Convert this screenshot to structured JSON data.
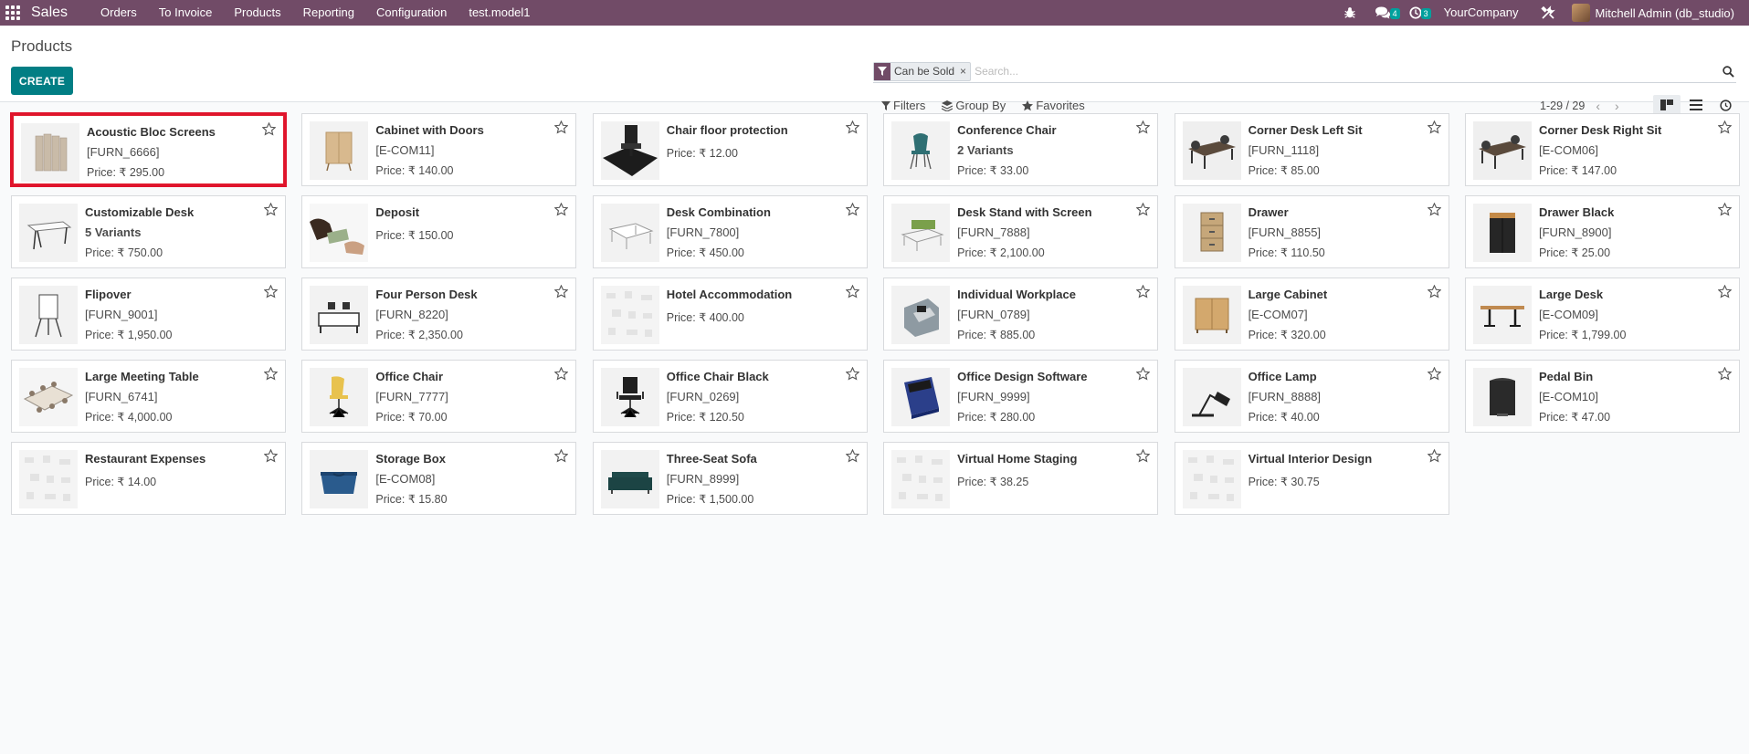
{
  "navbar": {
    "brand": "Sales",
    "menu": [
      "Orders",
      "To Invoice",
      "Products",
      "Reporting",
      "Configuration",
      "test.model1"
    ],
    "messages_count": "4",
    "activities_count": "3",
    "company": "YourCompany",
    "user": "Mitchell Admin (db_studio)"
  },
  "control": {
    "title": "Products",
    "create_label": "CREATE",
    "facet_label": "Can be Sold",
    "facet_remove": "×",
    "search_placeholder": "Search...",
    "filters_label": "Filters",
    "groupby_label": "Group By",
    "favorites_label": "Favorites",
    "pager": "1-29 / 29"
  },
  "colors": {
    "navbar": "#714b67",
    "create": "#017e84",
    "selection": "#e0202f"
  },
  "products": [
    {
      "name": "Acoustic Bloc Screens",
      "code": "[FURN_6666]",
      "price": "Price: ₹ 295.00",
      "thumb": "screens"
    },
    {
      "name": "Cabinet with Doors",
      "code": "[E-COM11]",
      "price": "Price: ₹ 140.00",
      "thumb": "cabinet"
    },
    {
      "name": "Chair floor protection",
      "code": "",
      "price": "Price: ₹ 12.00",
      "thumb": "mat"
    },
    {
      "name": "Conference Chair",
      "code": "2 Variants",
      "price": "Price: ₹ 33.00",
      "thumb": "chair-teal"
    },
    {
      "name": "Corner Desk Left Sit",
      "code": "[FURN_1118]",
      "price": "Price: ₹ 85.00",
      "thumb": "desk-dark"
    },
    {
      "name": "Corner Desk Right Sit",
      "code": "[E-COM06]",
      "price": "Price: ₹ 147.00",
      "thumb": "desk-dark"
    },
    {
      "name": "Customizable Desk",
      "code": "5 Variants",
      "price": "Price: ₹ 750.00",
      "thumb": "desk-white"
    },
    {
      "name": "Deposit",
      "code": "",
      "price": "Price: ₹ 150.00",
      "thumb": "money"
    },
    {
      "name": "Desk Combination",
      "code": "[FURN_7800]",
      "price": "Price: ₹ 450.00",
      "thumb": "desk-combo"
    },
    {
      "name": "Desk Stand with Screen",
      "code": "[FURN_7888]",
      "price": "Price: ₹ 2,100.00",
      "thumb": "desk-screen"
    },
    {
      "name": "Drawer",
      "code": "[FURN_8855]",
      "price": "Price: ₹ 110.50",
      "thumb": "drawer"
    },
    {
      "name": "Drawer Black",
      "code": "[FURN_8900]",
      "price": "Price: ₹ 25.00",
      "thumb": "drawer-black"
    },
    {
      "name": "Flipover",
      "code": "[FURN_9001]",
      "price": "Price: ₹ 1,950.00",
      "thumb": "flipover"
    },
    {
      "name": "Four Person Desk",
      "code": "[FURN_8220]",
      "price": "Price: ₹ 2,350.00",
      "thumb": "four-desk"
    },
    {
      "name": "Hotel Accommodation",
      "code": "",
      "price": "Price: ₹ 400.00",
      "thumb": "placeholder"
    },
    {
      "name": "Individual Workplace",
      "code": "[FURN_0789]",
      "price": "Price: ₹ 885.00",
      "thumb": "workplace"
    },
    {
      "name": "Large Cabinet",
      "code": "[E-COM07]",
      "price": "Price: ₹ 320.00",
      "thumb": "large-cabinet"
    },
    {
      "name": "Large Desk",
      "code": "[E-COM09]",
      "price": "Price: ₹ 1,799.00",
      "thumb": "large-desk"
    },
    {
      "name": "Large Meeting Table",
      "code": "[FURN_6741]",
      "price": "Price: ₹ 4,000.00",
      "thumb": "meeting"
    },
    {
      "name": "Office Chair",
      "code": "[FURN_7777]",
      "price": "Price: ₹ 70.00",
      "thumb": "chair-yellow"
    },
    {
      "name": "Office Chair Black",
      "code": "[FURN_0269]",
      "price": "Price: ₹ 120.50",
      "thumb": "chair-black"
    },
    {
      "name": "Office Design Software",
      "code": "[FURN_9999]",
      "price": "Price: ₹ 280.00",
      "thumb": "software"
    },
    {
      "name": "Office Lamp",
      "code": "[FURN_8888]",
      "price": "Price: ₹ 40.00",
      "thumb": "lamp"
    },
    {
      "name": "Pedal Bin",
      "code": "[E-COM10]",
      "price": "Price: ₹ 47.00",
      "thumb": "bin"
    },
    {
      "name": "Restaurant Expenses",
      "code": "",
      "price": "Price: ₹ 14.00",
      "thumb": "placeholder"
    },
    {
      "name": "Storage Box",
      "code": "[E-COM08]",
      "price": "Price: ₹ 15.80",
      "thumb": "box"
    },
    {
      "name": "Three-Seat Sofa",
      "code": "[FURN_8999]",
      "price": "Price: ₹ 1,500.00",
      "thumb": "sofa"
    },
    {
      "name": "Virtual Home Staging",
      "code": "",
      "price": "Price: ₹ 38.25",
      "thumb": "placeholder"
    },
    {
      "name": "Virtual Interior Design",
      "code": "",
      "price": "Price: ₹ 30.75",
      "thumb": "placeholder"
    }
  ]
}
